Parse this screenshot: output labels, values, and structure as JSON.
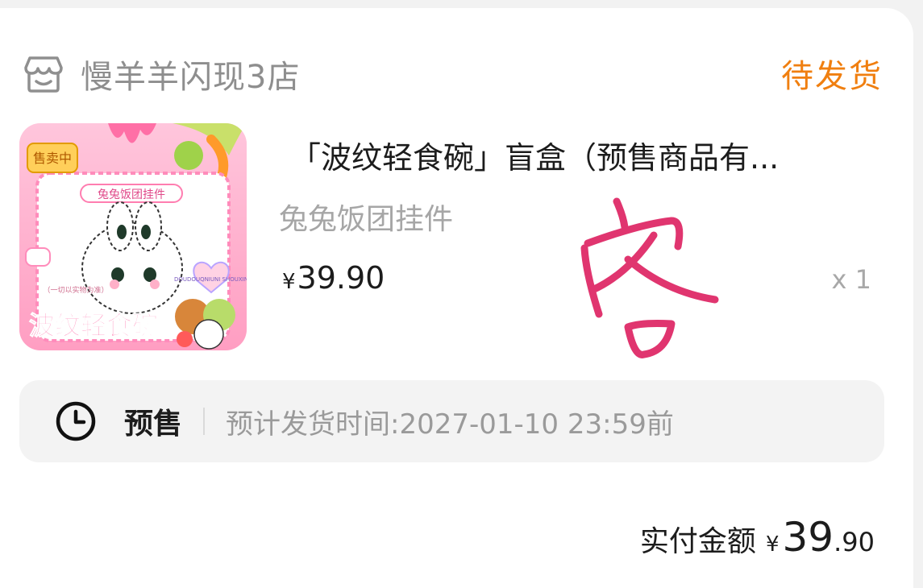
{
  "shop": {
    "name": "慢羊羊闪现3店",
    "icon": "store-icon"
  },
  "order_status": "待发货",
  "product": {
    "title": "「波纹轻食碗」盲盒（预售商品有...",
    "variant": "兔兔饭团挂件",
    "price_symbol": "¥",
    "price": "39.90",
    "quantity": "x 1",
    "image": {
      "badge": "售卖中",
      "banner": "兔兔饭团挂件",
      "note": "（一切以实物为准）",
      "brand": "波纹轻食碗",
      "side_text": "DOUDOUQNIUNI SHOUXIN"
    }
  },
  "presale": {
    "icon": "clock-icon",
    "label": "预售",
    "time_text": "预计发货时间:2027-01-10 23:59前"
  },
  "payment": {
    "label": "实付金额",
    "symbol": "¥",
    "amount_int": "39",
    "amount_dec": ".90"
  },
  "handwritten_mark": "客",
  "colors": {
    "status": "#f07f10",
    "mark": "#e0356f"
  }
}
